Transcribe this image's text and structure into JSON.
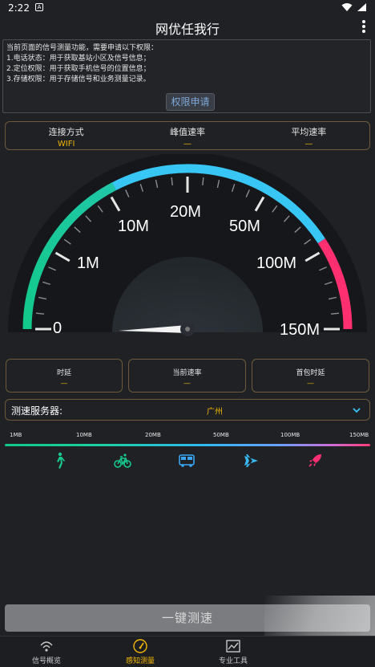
{
  "status_bar": {
    "time": "2:22",
    "a_badge": "A"
  },
  "app": {
    "title": "网优任我行"
  },
  "permission": {
    "lines": [
      "当前页面的信号测量功能，需要申请以下权限：",
      "1.电话状态：用于获取基站小区及信号信息；",
      "2.定位权限：用于获取手机信号的位置信息；",
      "3.存储权限：用于存储信号和业务测量记录。"
    ],
    "button_label": "权限申请"
  },
  "top_stats": [
    {
      "label": "连接方式",
      "value": "WIFI"
    },
    {
      "label": "峰值速率",
      "value": "—"
    },
    {
      "label": "平均速率",
      "value": "—"
    }
  ],
  "gauge": {
    "labels": [
      "0",
      "1M",
      "10M",
      "20M",
      "50M",
      "100M",
      "150M"
    ],
    "current_value": 0,
    "colors": {
      "green": "#17c98c",
      "blue": "#38c6f4",
      "pink": "#ff2f72"
    }
  },
  "metrics": [
    {
      "label": "时延",
      "value": "—"
    },
    {
      "label": "当前速率",
      "value": "—"
    },
    {
      "label": "首包时延",
      "value": "—"
    }
  ],
  "server": {
    "label": "测速服务器:",
    "value": "广州"
  },
  "scale": {
    "labels": [
      "1MB",
      "10MB",
      "20MB",
      "50MB",
      "100MB",
      "150MB"
    ],
    "icons": [
      "walk-icon",
      "bicycle-icon",
      "bus-icon",
      "airplane-icon",
      "rocket-icon"
    ]
  },
  "start_button": {
    "label": "一键测速"
  },
  "bottom_nav": [
    {
      "label": "信号概览",
      "icon": "signal-icon"
    },
    {
      "label": "感知测量",
      "icon": "speedometer-icon",
      "active": true
    },
    {
      "label": "专业工具",
      "icon": "chart-icon"
    }
  ],
  "accent": "#f2b705"
}
